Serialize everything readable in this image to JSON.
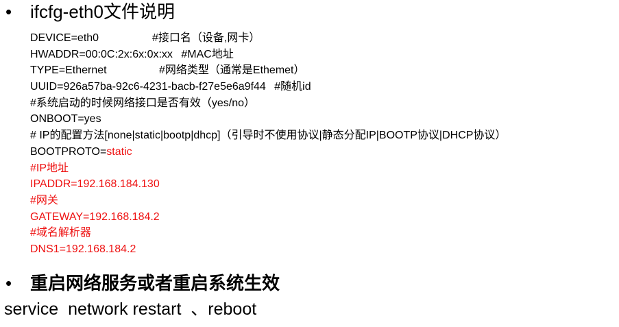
{
  "heading1": {
    "bullet": "•",
    "text": "ifcfg-eth0文件说明"
  },
  "config_lines": [
    {
      "text": "DEVICE=eth0",
      "comment": "#接口名（设备,网卡）"
    },
    {
      "text": "HWADDR=00:0C:2x:6x:0x:xx",
      "comment": "#MAC地址"
    },
    {
      "text": "TYPE=Ethernet",
      "comment": "#网络类型（通常是Ethemet）"
    },
    {
      "text": "UUID=926a57ba-92c6-4231-bacb-f27e5e6a9f44",
      "comment": "#随机id"
    },
    {
      "text": "#系统启动的时候网络接口是否有效（yes/no）"
    },
    {
      "text": "ONBOOT=yes"
    },
    {
      "text": "# IP的配置方法[none|static|bootp|dhcp]（引导时不使用协议|静态分配IP|BOOTP协议|DHCP协议）"
    },
    {
      "key": "BOOTPROTO=",
      "value": "static"
    },
    {
      "text": "#IP地址"
    },
    {
      "text": "IPADDR=192.168.184.130"
    },
    {
      "text": "#网关"
    },
    {
      "text": "GATEWAY=192.168.184.2"
    },
    {
      "text": "#域名解析器"
    },
    {
      "text": "DNS1=192.168.184.2"
    }
  ],
  "heading2": {
    "bullet": "•",
    "text": "重启网络服务或者重启系统生效"
  },
  "command": "service  network restart  、reboot",
  "colors": {
    "highlight": "#ee1111",
    "text": "#000000"
  }
}
